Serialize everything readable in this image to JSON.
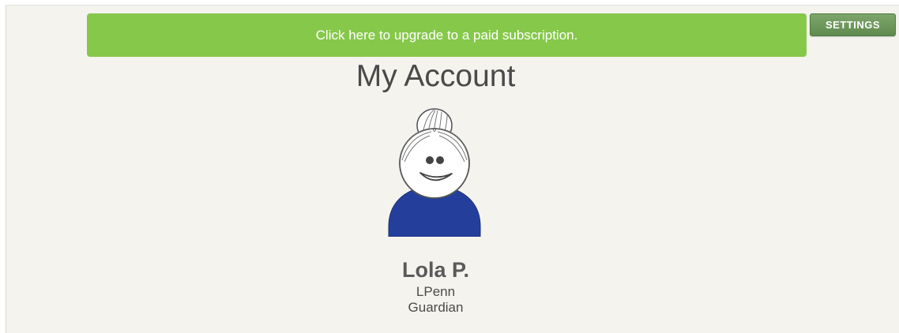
{
  "banner": {
    "text": "Click here to upgrade to a paid subscription.",
    "color": "#86c84a"
  },
  "settings": {
    "label": "SETTINGS"
  },
  "page": {
    "title": "My Account"
  },
  "profile": {
    "avatar": "grandmother-avatar-icon",
    "shirt_color": "#243f9b",
    "name": "Lola P.",
    "username": "LPenn",
    "role": "Guardian"
  }
}
